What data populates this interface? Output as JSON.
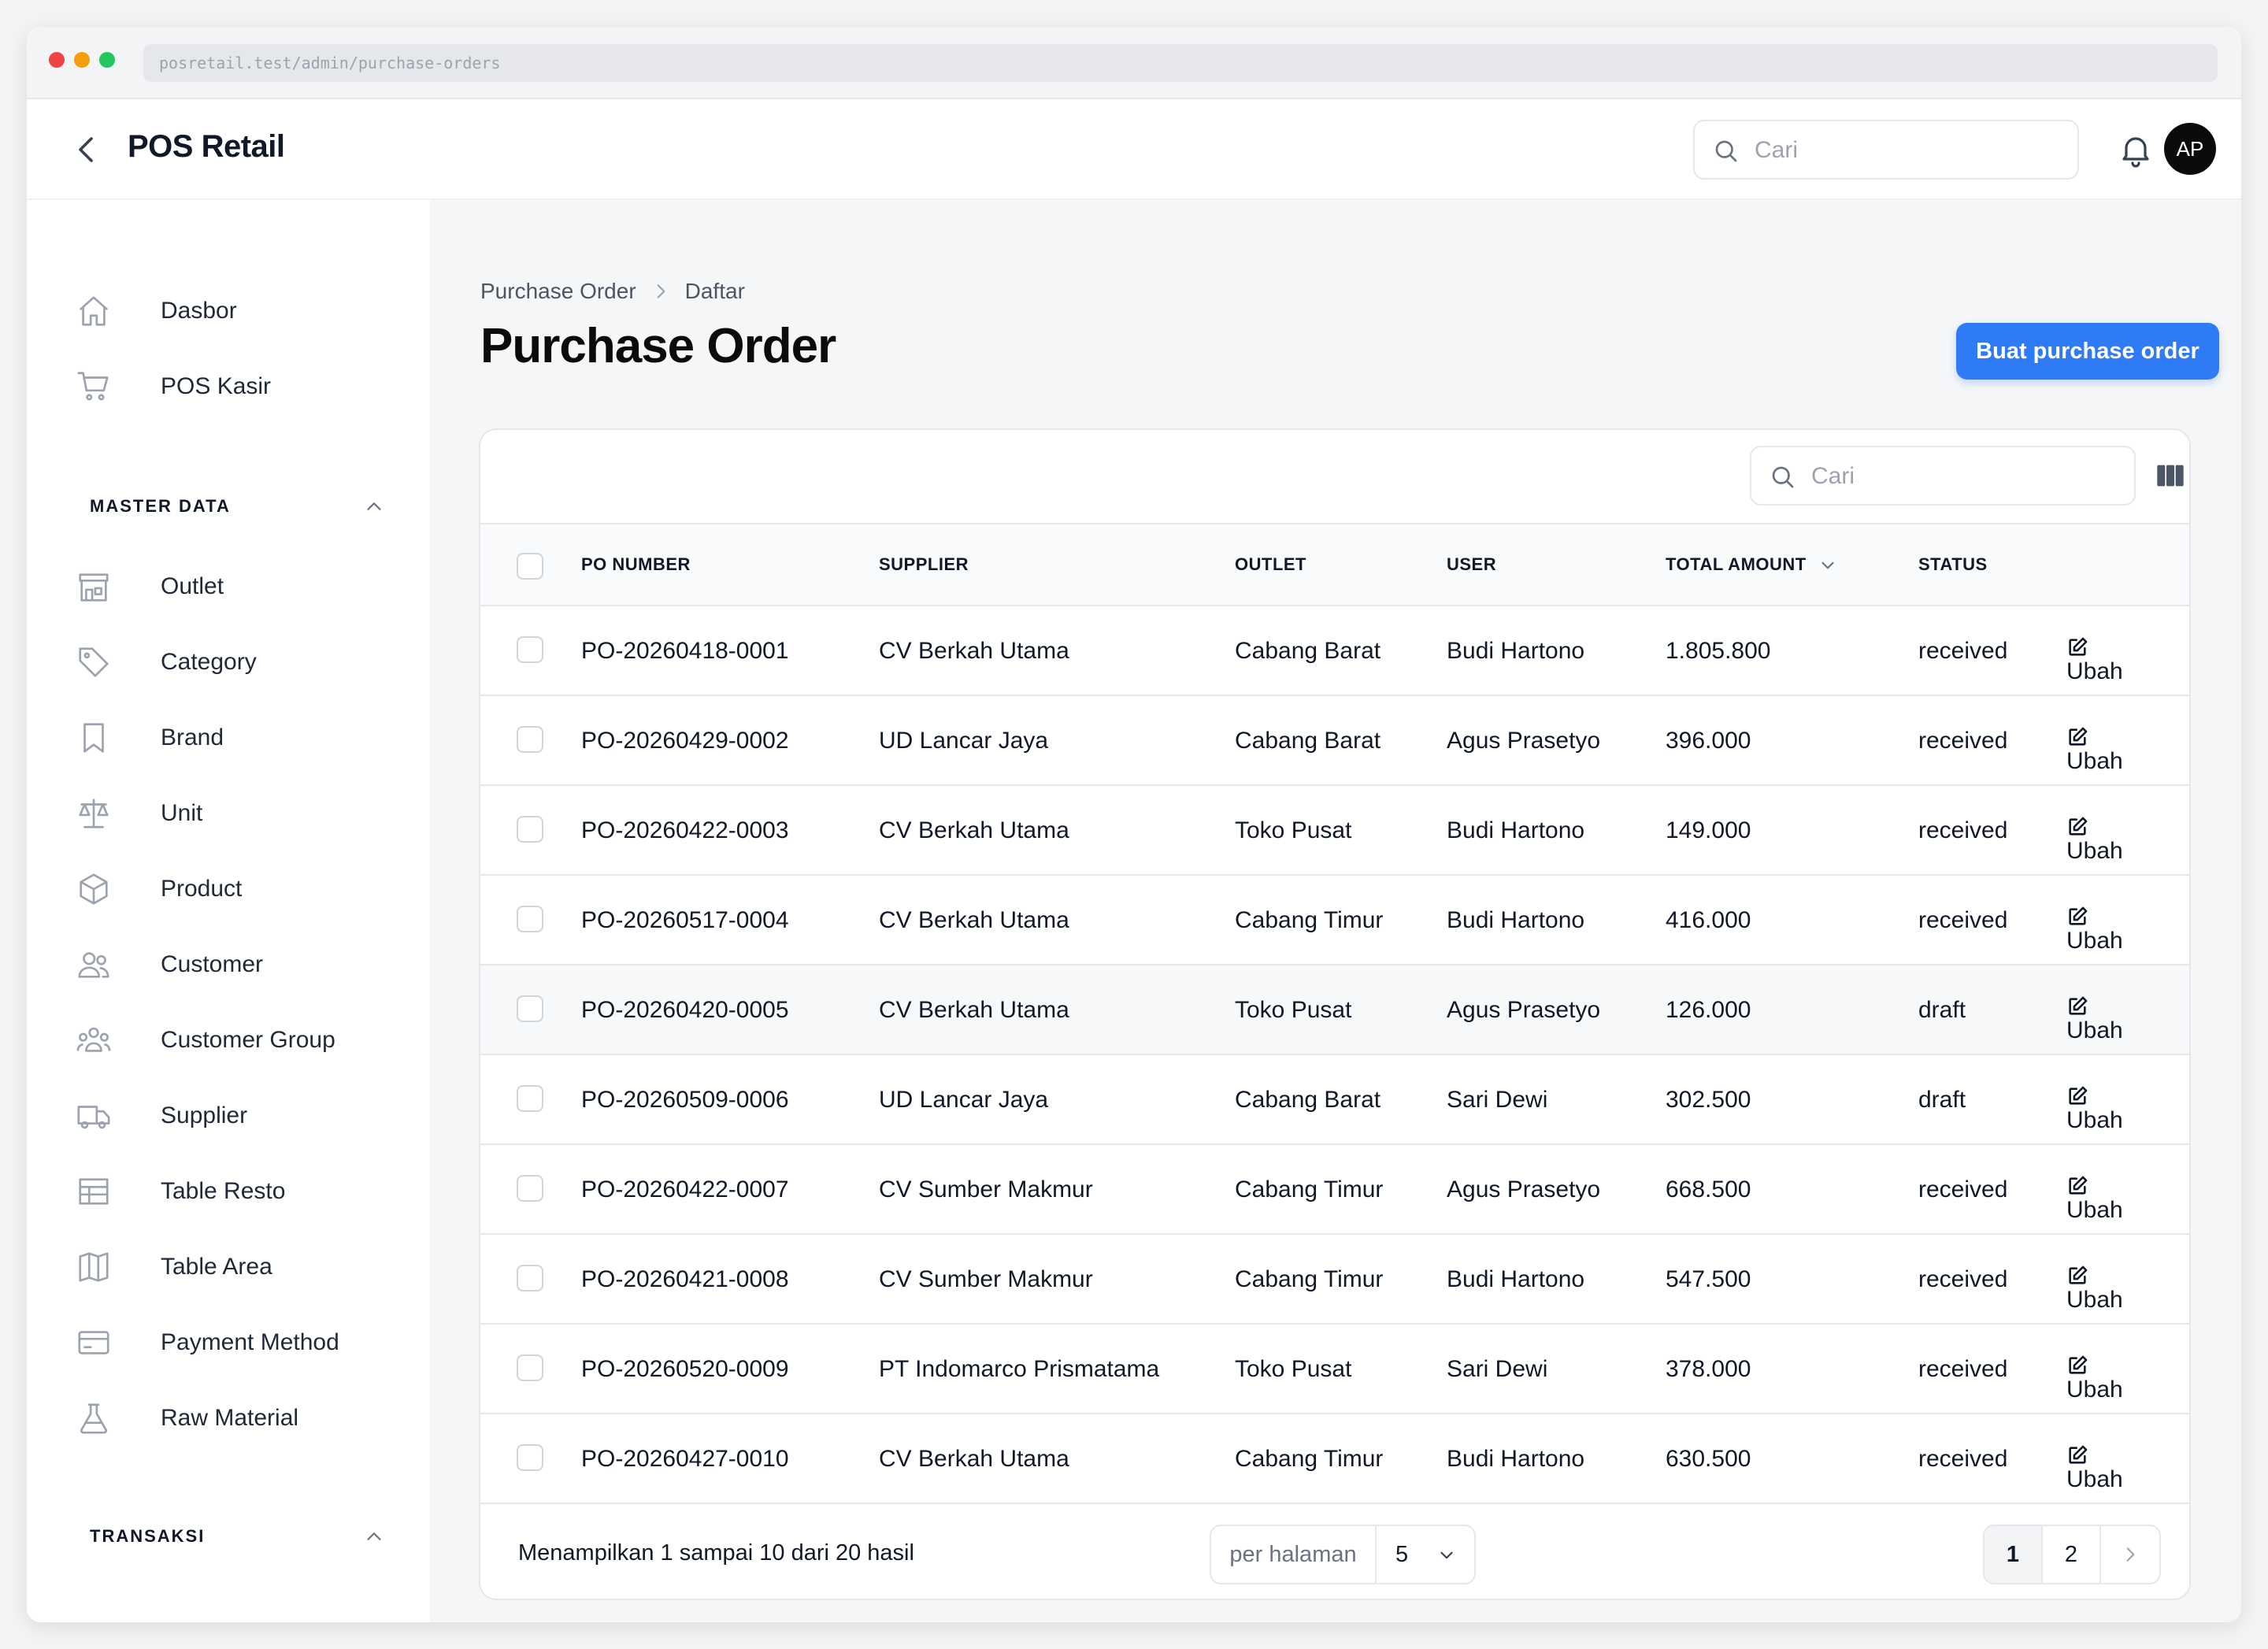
{
  "browser": {
    "url": "posretail.test/admin/purchase-orders"
  },
  "header": {
    "app_title": "POS Retail",
    "search_placeholder": "Cari",
    "avatar_initials": "AP"
  },
  "sidebar": {
    "top_items": [
      {
        "label": "Dasbor",
        "icon": "home-icon"
      },
      {
        "label": "POS Kasir",
        "icon": "shopping-cart-icon"
      }
    ],
    "sections": [
      {
        "title": "MASTER DATA",
        "items": [
          {
            "label": "Outlet",
            "icon": "store-icon"
          },
          {
            "label": "Category",
            "icon": "tag-icon"
          },
          {
            "label": "Brand",
            "icon": "bookmark-icon"
          },
          {
            "label": "Unit",
            "icon": "scale-icon"
          },
          {
            "label": "Product",
            "icon": "cube-icon"
          },
          {
            "label": "Customer",
            "icon": "users-icon"
          },
          {
            "label": "Customer Group",
            "icon": "user-group-icon"
          },
          {
            "label": "Supplier",
            "icon": "truck-icon"
          },
          {
            "label": "Table Resto",
            "icon": "table-icon"
          },
          {
            "label": "Table Area",
            "icon": "map-icon"
          },
          {
            "label": "Payment Method",
            "icon": "credit-card-icon"
          },
          {
            "label": "Raw Material",
            "icon": "beaker-icon"
          }
        ]
      },
      {
        "title": "TRANSAKSI",
        "items": []
      }
    ]
  },
  "page": {
    "breadcrumb": [
      "Purchase Order",
      "Daftar"
    ],
    "title": "Purchase Order",
    "create_button": "Buat purchase order"
  },
  "table": {
    "search_placeholder": "Cari",
    "columns": [
      "PO NUMBER",
      "SUPPLIER",
      "OUTLET",
      "USER",
      "TOTAL AMOUNT",
      "STATUS"
    ],
    "edit_label": "Ubah",
    "rows": [
      {
        "po": "PO-20260418-0001",
        "supplier": "CV Berkah Utama",
        "outlet": "Cabang Barat",
        "user": "Budi Hartono",
        "total": "1.805.800",
        "status": "received"
      },
      {
        "po": "PO-20260429-0002",
        "supplier": "UD Lancar Jaya",
        "outlet": "Cabang Barat",
        "user": "Agus Prasetyo",
        "total": "396.000",
        "status": "received"
      },
      {
        "po": "PO-20260422-0003",
        "supplier": "CV Berkah Utama",
        "outlet": "Toko Pusat",
        "user": "Budi Hartono",
        "total": "149.000",
        "status": "received"
      },
      {
        "po": "PO-20260517-0004",
        "supplier": "CV Berkah Utama",
        "outlet": "Cabang Timur",
        "user": "Budi Hartono",
        "total": "416.000",
        "status": "received"
      },
      {
        "po": "PO-20260420-0005",
        "supplier": "CV Berkah Utama",
        "outlet": "Toko Pusat",
        "user": "Agus Prasetyo",
        "total": "126.000",
        "status": "draft"
      },
      {
        "po": "PO-20260509-0006",
        "supplier": "UD Lancar Jaya",
        "outlet": "Cabang Barat",
        "user": "Sari Dewi",
        "total": "302.500",
        "status": "draft"
      },
      {
        "po": "PO-20260422-0007",
        "supplier": "CV Sumber Makmur",
        "outlet": "Cabang Timur",
        "user": "Agus Prasetyo",
        "total": "668.500",
        "status": "received"
      },
      {
        "po": "PO-20260421-0008",
        "supplier": "CV Sumber Makmur",
        "outlet": "Cabang Timur",
        "user": "Budi Hartono",
        "total": "547.500",
        "status": "received"
      },
      {
        "po": "PO-20260520-0009",
        "supplier": "PT Indomarco Prismatama",
        "outlet": "Toko Pusat",
        "user": "Sari Dewi",
        "total": "378.000",
        "status": "received"
      },
      {
        "po": "PO-20260427-0010",
        "supplier": "CV Berkah Utama",
        "outlet": "Cabang Timur",
        "user": "Budi Hartono",
        "total": "630.500",
        "status": "received"
      }
    ],
    "footer": {
      "summary": "Menampilkan 1 sampai 10 dari 20 hasil",
      "per_page_label": "per halaman",
      "per_page_value": "5",
      "pages": [
        "1",
        "2"
      ],
      "current_page": "1"
    }
  },
  "colors": {
    "primary": "#2f7bf6",
    "sidebar_bg": "#ffffff",
    "main_bg": "#f5f6f8",
    "text": "#111827"
  }
}
